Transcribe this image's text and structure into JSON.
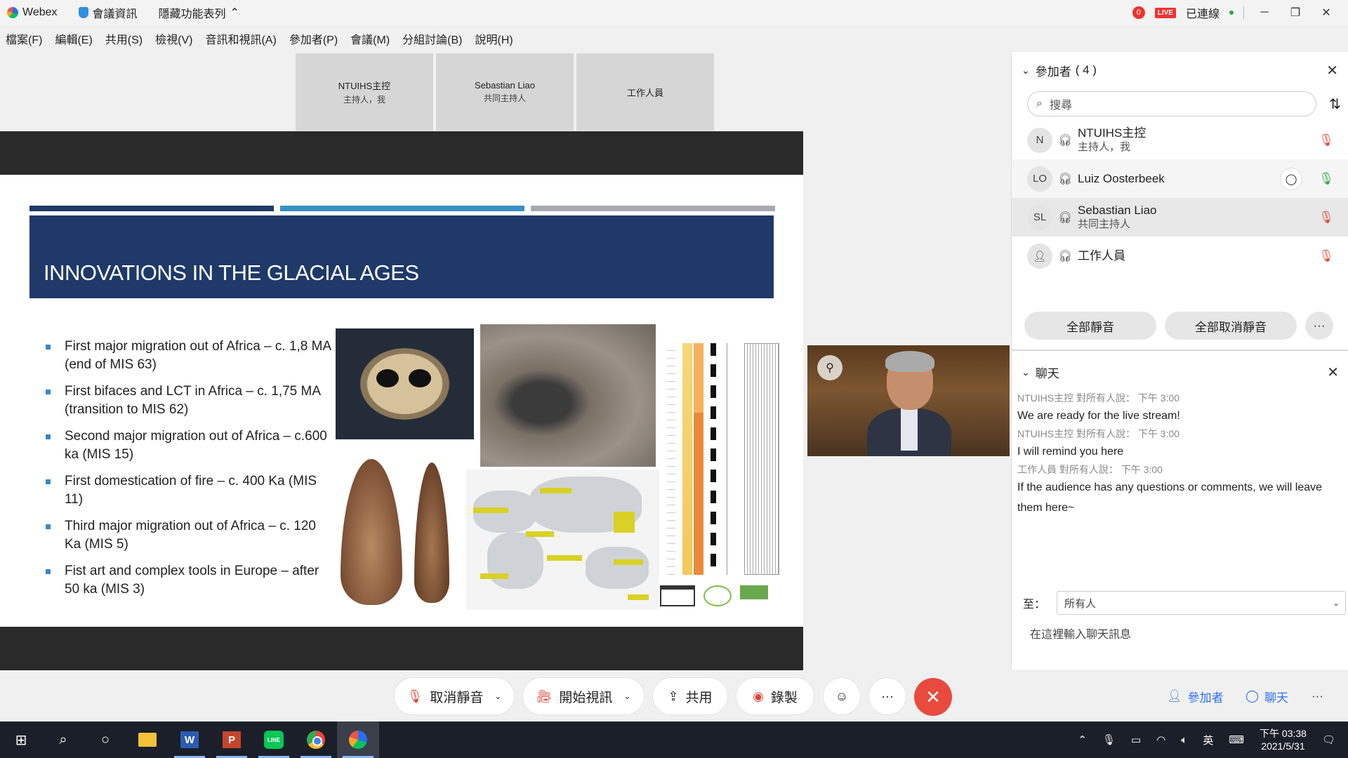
{
  "titlebar": {
    "app_name": "Webex",
    "meeting_info": "會議資訊",
    "hide_menu": "隱藏功能表列",
    "hide_menu_icon": "chevron-up-icon",
    "rec_count": "0",
    "live": "LIVE",
    "connected": "已連線"
  },
  "menu": [
    "檔案(F)",
    "編輯(E)",
    "共用(S)",
    "檢視(V)",
    "音訊和視訊(A)",
    "參加者(P)",
    "會議(M)",
    "分組討論(B)",
    "說明(H)"
  ],
  "video_tiles": [
    {
      "name": "NTUIHS主控",
      "role": "主持人，我"
    },
    {
      "name": "Sebastian Liao",
      "role": "共同主持人"
    },
    {
      "name": "工作人員",
      "role": ""
    }
  ],
  "slide": {
    "title": "INNOVATIONS IN THE GLACIAL AGES",
    "bar_colors": [
      "#1f3968",
      "#3a8fc3",
      "#a7a9b4"
    ],
    "bullets": [
      "First major migration out of Africa – c. 1,8 MA (end of MIS 63)",
      "First bifaces and LCT in Africa – c. 1,75 MA (transition to MIS 62)",
      "Second major migration out of Africa – c.600 ka (MIS 15)",
      "First domestication of fire – c. 400 Ka (MIS 11)",
      "Third major migration out of Africa – c. 120 Ka (MIS 5)",
      "Fist art and complex tools in Europe – after 50 ka (MIS 3)"
    ]
  },
  "participants": {
    "header": "參加者",
    "count": "( 4 )",
    "search_placeholder": "搜尋",
    "list": [
      {
        "initials": "N",
        "name": "NTUIHS主控",
        "role": "主持人，我",
        "mic": "muted"
      },
      {
        "initials": "LO",
        "name": "Luiz Oosterbeek",
        "role": "",
        "mic": "on"
      },
      {
        "initials": "SL",
        "name": "Sebastian Liao",
        "role": "共同主持人",
        "mic": "muted"
      },
      {
        "initials": "",
        "name": "工作人員",
        "role": "",
        "mic": "muted"
      }
    ],
    "mute_all": "全部靜音",
    "unmute_all": "全部取消靜音"
  },
  "chat": {
    "header": "聊天",
    "messages": [
      {
        "meta": "NTUIHS主控 對所有人說：   下午 3:00",
        "text": "We are ready for the live stream!"
      },
      {
        "meta": "NTUIHS主控 對所有人說：   下午 3:00",
        "text": "I will remind you here"
      },
      {
        "meta": "工作人員 對所有人說：   下午 3:00",
        "text": "If the audience has any questions or comments, we will leave them here~"
      }
    ],
    "to_label": "至：",
    "to_value": "所有人",
    "input_placeholder": "在這裡輸入聊天訊息"
  },
  "controls": {
    "unmute": "取消靜音",
    "start_video": "開始視訊",
    "share": "共用",
    "record": "錄製",
    "participants": "參加者",
    "chat": "聊天"
  },
  "taskbar": {
    "ime": "英",
    "time": "下午 03:38",
    "date": "2021/5/31"
  }
}
